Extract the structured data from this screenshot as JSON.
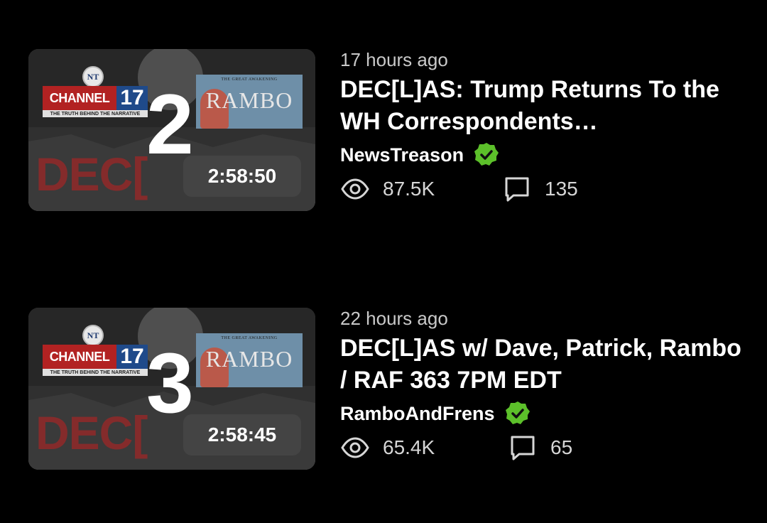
{
  "videos": [
    {
      "rank": "2",
      "duration": "2:58:50",
      "time_ago": "17 hours ago",
      "title": "DEC[L]AS: Trump Returns To the WH Correspondents…",
      "channel": "NewsTreason",
      "verified": true,
      "views": "87.5K",
      "comments": "135",
      "thumbnail": {
        "logo_text": "NT",
        "channel_word": "CHANNEL",
        "channel_number": "17",
        "channel_tagline": "THE TRUTH BEHIND THE NARRATIVE",
        "rambo_small": "THE GREAT AWAKENING",
        "rambo_word": "RAMBO",
        "dec_text": "DEC["
      }
    },
    {
      "rank": "3",
      "duration": "2:58:45",
      "time_ago": "22 hours ago",
      "title": "DEC[L]AS w/ Dave, Patrick, Rambo / RAF 363 7PM EDT",
      "channel": "RamboAndFrens",
      "verified": true,
      "views": "65.4K",
      "comments": "65",
      "thumbnail": {
        "logo_text": "NT",
        "channel_word": "CHANNEL",
        "channel_number": "17",
        "channel_tagline": "THE TRUTH BEHIND THE NARRATIVE",
        "rambo_small": "THE GREAT AWAKENING",
        "rambo_word": "RAMBO",
        "dec_text": "DEC["
      }
    }
  ],
  "colors": {
    "background": "#000000",
    "verified_badge": "#5cc02a",
    "secondary_text": "#c9c9c9"
  },
  "icons": {
    "views": "eye-icon",
    "comments": "comment-icon",
    "verified": "verified-check-icon"
  }
}
